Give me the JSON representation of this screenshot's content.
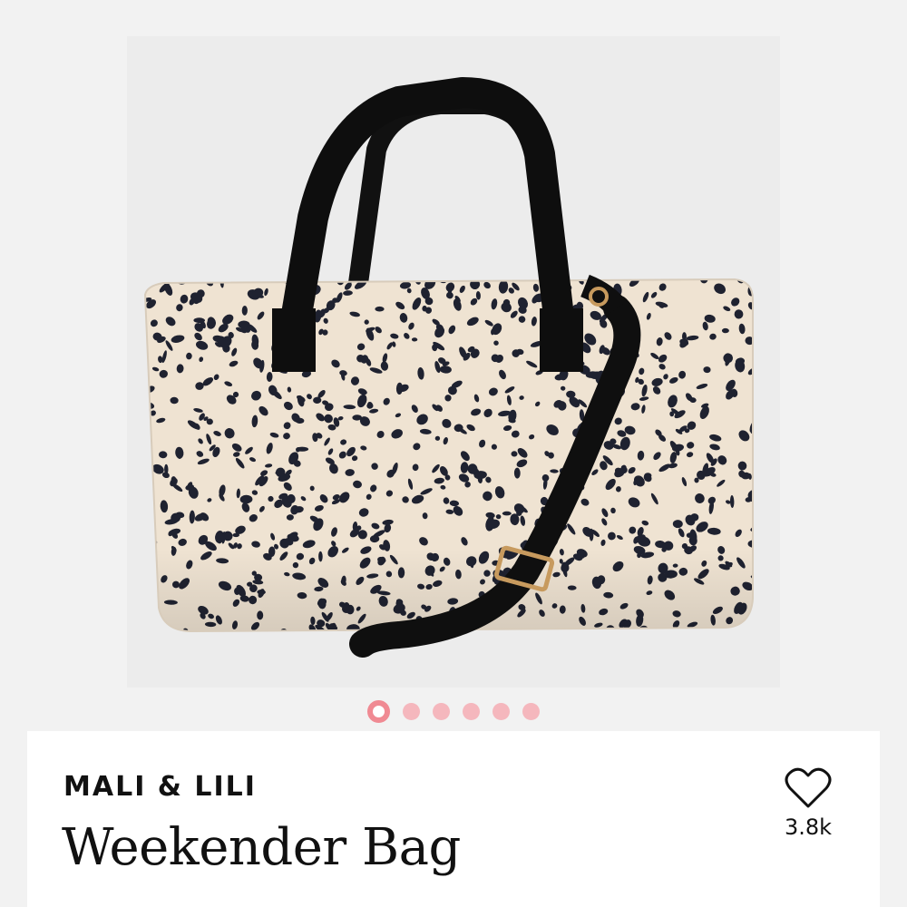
{
  "product": {
    "brand": "MALI & LILI",
    "title": "Weekender Bag",
    "favorite_count": "3.8k",
    "image_name": "leopard-print-weekender-bag-photo"
  },
  "gallery": {
    "total_images": 6,
    "active_index": 0
  },
  "icons": {
    "favorite": "heart-outline-icon"
  },
  "colors": {
    "pager_active": "#f08a93",
    "pager_inactive": "#f5b7bd",
    "bag_base": "#efe3d2",
    "spots": "#1f2230",
    "strap": "#111111",
    "hardware": "#c79a5e"
  }
}
